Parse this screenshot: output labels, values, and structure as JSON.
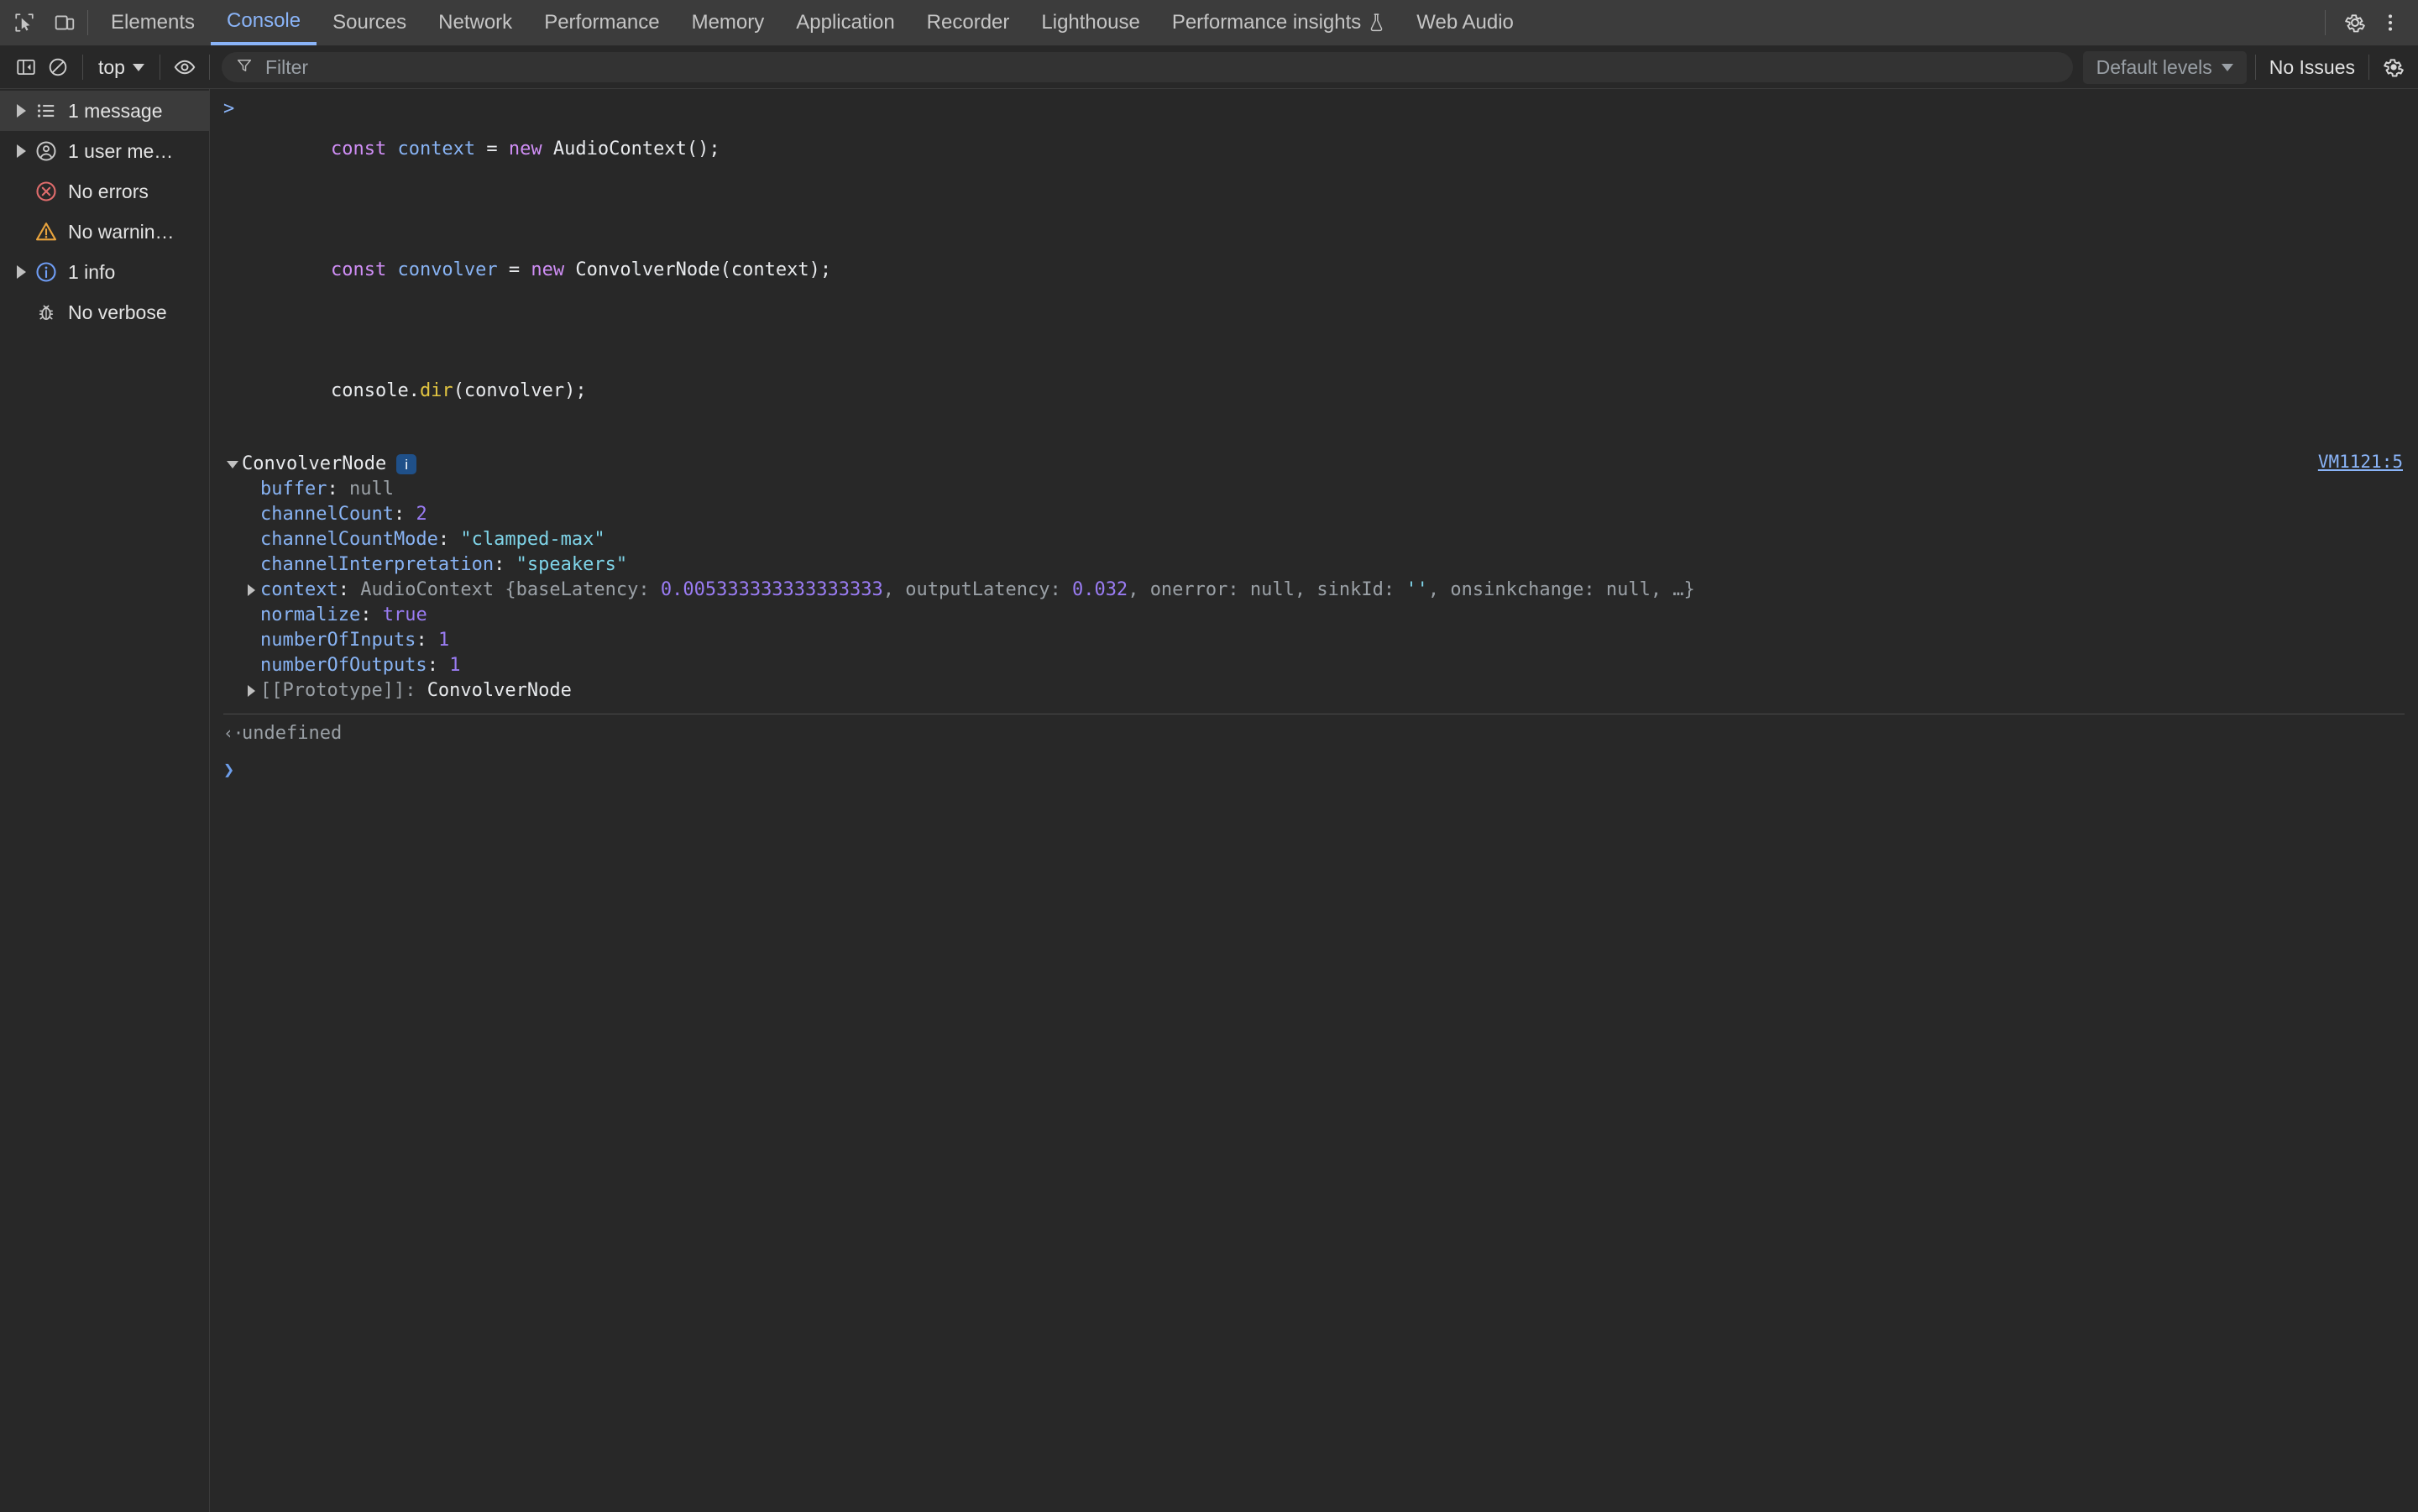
{
  "tabbar": {
    "inspect_icon": "inspect-cursor-icon",
    "device_icon": "device-toolbar-icon",
    "tabs": [
      {
        "label": "Elements",
        "selected": false
      },
      {
        "label": "Console",
        "selected": true
      },
      {
        "label": "Sources",
        "selected": false
      },
      {
        "label": "Network",
        "selected": false
      },
      {
        "label": "Performance",
        "selected": false
      },
      {
        "label": "Memory",
        "selected": false
      },
      {
        "label": "Application",
        "selected": false
      },
      {
        "label": "Recorder",
        "selected": false,
        "experimental": true
      },
      {
        "label": "Lighthouse",
        "selected": false
      },
      {
        "label": "Performance insights",
        "selected": false,
        "experimental": true
      },
      {
        "label": "Web Audio",
        "selected": false
      }
    ],
    "settings_icon": "gear-icon",
    "more_icon": "more-vertical-icon"
  },
  "toolbar": {
    "sidebar_toggle_icon": "sidebar-toggle-icon",
    "clear_console_icon": "clear-console-icon",
    "context": "top",
    "eye_icon": "live-expression-eye-icon",
    "filter_icon": "filter-funnel-icon",
    "filter_placeholder": "Filter",
    "filter_value": "",
    "levels_label": "Default levels",
    "issues_label": "No Issues",
    "settings_icon": "gear-icon"
  },
  "sidebar": {
    "items": [
      {
        "label": "1 message",
        "icon": "list-icon",
        "expandable": true,
        "active": true
      },
      {
        "label": "1 user me…",
        "icon": "user-icon",
        "expandable": true,
        "active": false
      },
      {
        "label": "No errors",
        "icon": "error-icon",
        "expandable": false,
        "active": false
      },
      {
        "label": "No warnin…",
        "icon": "warning-icon",
        "expandable": false,
        "active": false
      },
      {
        "label": "1 info",
        "icon": "info-icon",
        "expandable": true,
        "active": false
      },
      {
        "label": "No verbose",
        "icon": "bug-icon",
        "expandable": false,
        "active": false
      }
    ]
  },
  "console": {
    "input_lines": [
      {
        "prompt": ">",
        "tokens": [
          {
            "t": "const",
            "c": "t-kw"
          },
          {
            "t": " ",
            "c": "t-plain"
          },
          {
            "t": "context",
            "c": "t-var"
          },
          {
            "t": " = ",
            "c": "t-plain"
          },
          {
            "t": "new",
            "c": "t-kw"
          },
          {
            "t": " ",
            "c": "t-plain"
          },
          {
            "t": "AudioContext();",
            "c": "t-plain"
          }
        ]
      },
      {
        "prompt": "",
        "tokens": [
          {
            "t": "const",
            "c": "t-kw"
          },
          {
            "t": " ",
            "c": "t-plain"
          },
          {
            "t": "convolver",
            "c": "t-var"
          },
          {
            "t": " = ",
            "c": "t-plain"
          },
          {
            "t": "new",
            "c": "t-kw"
          },
          {
            "t": " ",
            "c": "t-plain"
          },
          {
            "t": "ConvolverNode(context);",
            "c": "t-plain"
          }
        ]
      },
      {
        "prompt": "",
        "tokens": [
          {
            "t": "console.",
            "c": "t-plain"
          },
          {
            "t": "dir",
            "c": "t-fn"
          },
          {
            "t": "(convolver);",
            "c": "t-plain"
          }
        ]
      }
    ],
    "object_output": {
      "header": "ConvolverNode",
      "info_badge": "i",
      "source_link": "VM1121:5",
      "properties": [
        {
          "key": "buffer",
          "sep": ": ",
          "value": "null",
          "vclass": "t-null",
          "expandable": false
        },
        {
          "key": "channelCount",
          "sep": ": ",
          "value": "2",
          "vclass": "t-num",
          "expandable": false
        },
        {
          "key": "channelCountMode",
          "sep": ": ",
          "value": "\"clamped-max\"",
          "vclass": "t-str",
          "expandable": false
        },
        {
          "key": "channelInterpretation",
          "sep": ": ",
          "value": "\"speakers\"",
          "vclass": "t-str",
          "expandable": false
        },
        {
          "key": "context",
          "sep": ": ",
          "expandable": true,
          "rich": [
            {
              "t": "AudioContext {",
              "c": "t-dim"
            },
            {
              "t": "baseLatency",
              "c": "t-dim"
            },
            {
              "t": ": ",
              "c": "t-dim"
            },
            {
              "t": "0.005333333333333333",
              "c": "t-num"
            },
            {
              "t": ", ",
              "c": "t-dim"
            },
            {
              "t": "outputLatency",
              "c": "t-dim"
            },
            {
              "t": ": ",
              "c": "t-dim"
            },
            {
              "t": "0.032",
              "c": "t-num"
            },
            {
              "t": ", ",
              "c": "t-dim"
            },
            {
              "t": "onerror",
              "c": "t-dim"
            },
            {
              "t": ": ",
              "c": "t-dim"
            },
            {
              "t": "null",
              "c": "t-null"
            },
            {
              "t": ", ",
              "c": "t-dim"
            },
            {
              "t": "sinkId",
              "c": "t-dim"
            },
            {
              "t": ": ",
              "c": "t-dim"
            },
            {
              "t": "''",
              "c": "t-str"
            },
            {
              "t": ", ",
              "c": "t-dim"
            },
            {
              "t": "onsinkchange",
              "c": "t-dim"
            },
            {
              "t": ": ",
              "c": "t-dim"
            },
            {
              "t": "null",
              "c": "t-null"
            },
            {
              "t": ", …}",
              "c": "t-dim"
            }
          ]
        },
        {
          "key": "normalize",
          "sep": ": ",
          "value": "true",
          "vclass": "t-num",
          "expandable": false
        },
        {
          "key": "numberOfInputs",
          "sep": ": ",
          "value": "1",
          "vclass": "t-num",
          "expandable": false
        },
        {
          "key": "numberOfOutputs",
          "sep": ": ",
          "value": "1",
          "vclass": "t-num",
          "expandable": false
        },
        {
          "key": "[[Prototype]]",
          "sep": ": ",
          "value": "ConvolverNode",
          "vclass": "t-name",
          "kclass": "t-dim",
          "expandable": true
        }
      ]
    },
    "result": {
      "arrow": "‹·",
      "value": "undefined"
    },
    "prompt_symbol": "❯"
  }
}
